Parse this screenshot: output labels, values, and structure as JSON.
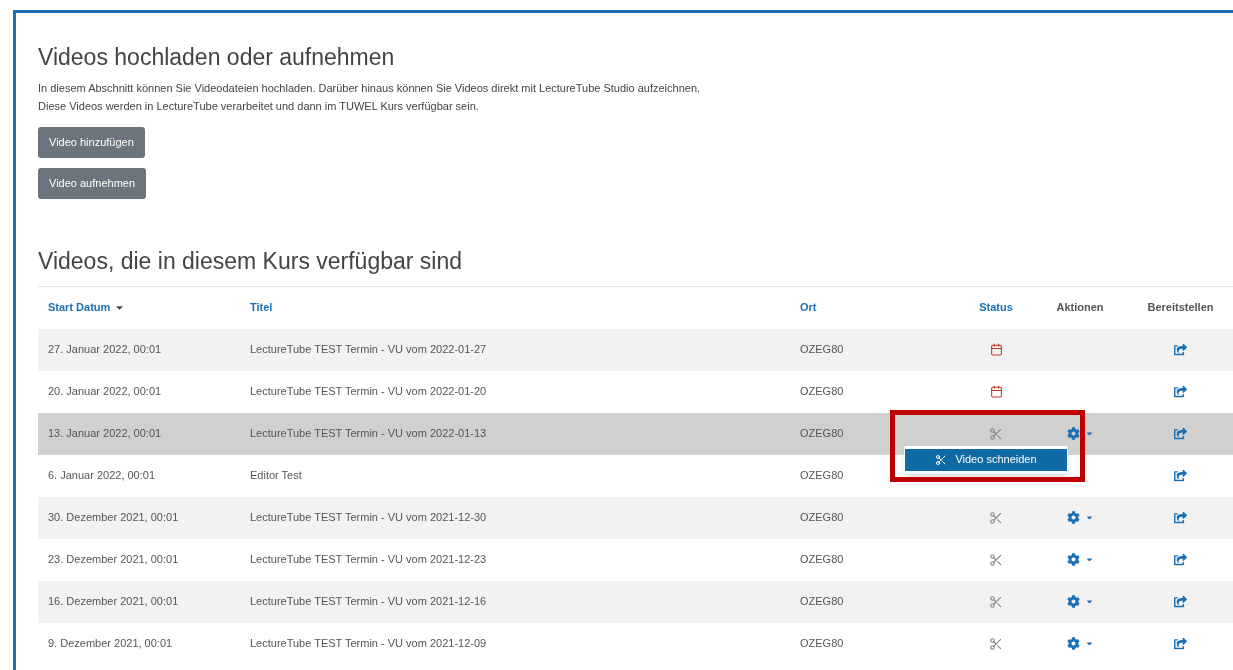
{
  "upload_section": {
    "title": "Videos hochladen oder aufnehmen",
    "description": [
      "In diesem Abschnitt können Sie Videodateien hochladen. Darüber hinaus können Sie Videos direkt mit LectureTube Studio aufzeichnen.",
      "Diese Videos werden in LectureTube verarbeitet und dann im TUWEL Kurs verfügbar sein."
    ],
    "buttons": [
      "Video hinzufügen",
      "Video aufnehmen"
    ]
  },
  "videos_section": {
    "title": "Videos, die in diesem Kurs verfügbar sind"
  },
  "table": {
    "columns": [
      {
        "label": "Start Datum",
        "sortable": true,
        "sorted": true
      },
      {
        "label": "Titel",
        "sortable": true,
        "sorted": false
      },
      {
        "label": "Ort",
        "sortable": true,
        "sorted": false
      },
      {
        "label": "Status",
        "sortable": true,
        "sorted": false
      },
      {
        "label": "Aktionen",
        "sortable": false,
        "sorted": false
      },
      {
        "label": "Bereitstellen",
        "sortable": false,
        "sorted": false
      }
    ],
    "rows": [
      {
        "date": "27. Januar 2022, 00:01",
        "title": "LectureTube TEST Termin - VU vom 2022-01-27",
        "location": "OZEG80",
        "kind": "scheduled",
        "actions": false,
        "hovered": false
      },
      {
        "date": "20. Januar 2022, 00:01",
        "title": "LectureTube TEST Termin - VU vom 2022-01-20",
        "location": "OZEG80",
        "kind": "scheduled",
        "actions": false,
        "hovered": false
      },
      {
        "date": "13. Januar 2022, 00:01",
        "title": "LectureTube TEST Termin - VU vom 2022-01-13",
        "location": "OZEG80",
        "kind": "editable",
        "actions": true,
        "hovered": true,
        "menu": {
          "open": true,
          "items": [
            "Video schneiden"
          ]
        }
      },
      {
        "date": "6. Januar 2022, 00:01",
        "title": "Editor Test",
        "location": "OZEG80",
        "kind": "hidden",
        "actions": false,
        "hovered": false
      },
      {
        "date": "30. Dezember 2021, 00:01",
        "title": "LectureTube TEST Termin - VU vom 2021-12-30",
        "location": "OZEG80",
        "kind": "editable",
        "actions": true,
        "hovered": false
      },
      {
        "date": "23. Dezember 2021, 00:01",
        "title": "LectureTube TEST Termin - VU vom 2021-12-23",
        "location": "OZEG80",
        "kind": "editable",
        "actions": true,
        "hovered": false
      },
      {
        "date": "16. Dezember 2021, 00:01",
        "title": "LectureTube TEST Termin - VU vom 2021-12-16",
        "location": "OZEG80",
        "kind": "editable",
        "actions": true,
        "hovered": false
      },
      {
        "date": "9. Dezember 2021, 00:01",
        "title": "LectureTube TEST Termin - VU vom 2021-12-09",
        "location": "OZEG80",
        "kind": "editable",
        "actions": true,
        "hovered": false
      }
    ]
  }
}
